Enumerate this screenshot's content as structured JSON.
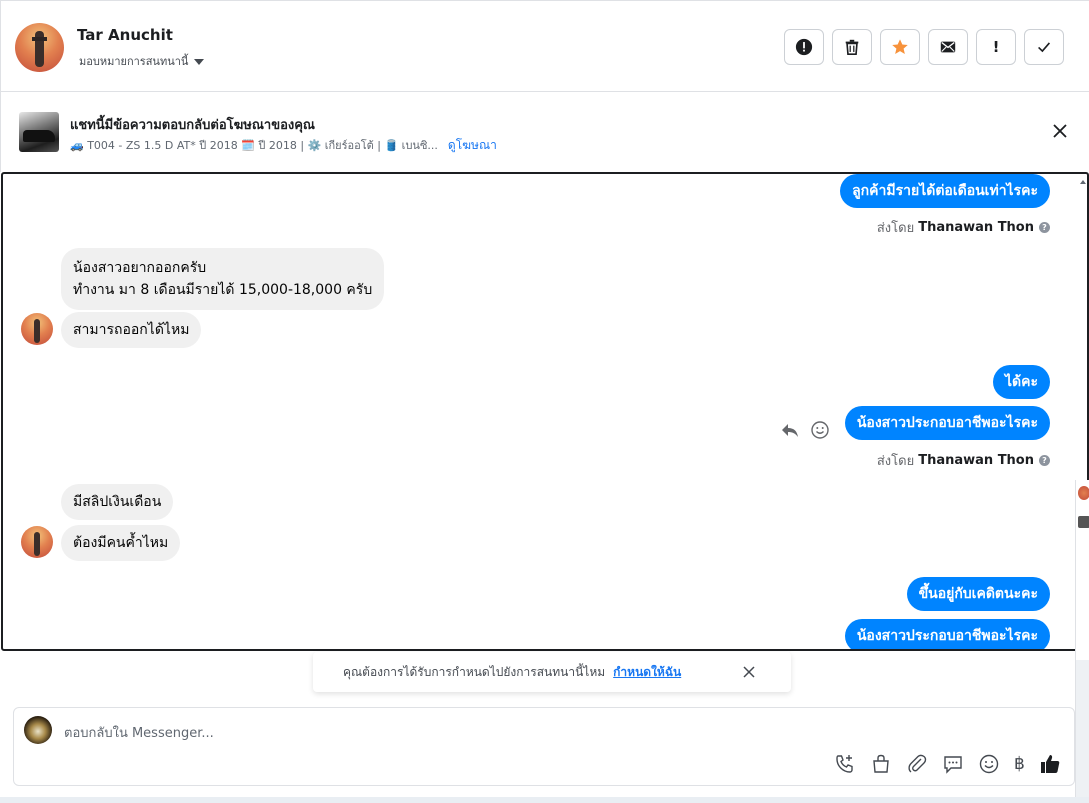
{
  "header": {
    "contact_name": "Tar Anuchit",
    "assign_label": "มอบหมายการสนทนานี้",
    "toolbar": [
      {
        "name": "spam-button",
        "icon": "alert-circle-icon"
      },
      {
        "name": "delete-button",
        "icon": "trash-icon"
      },
      {
        "name": "star-button",
        "icon": "star-icon"
      },
      {
        "name": "mark-unread-button",
        "icon": "envelope-icon"
      },
      {
        "name": "follow-up-button",
        "icon": "exclamation-icon",
        "glyph": "!"
      },
      {
        "name": "mark-done-button",
        "icon": "check-icon"
      }
    ],
    "star_color": "#f7923b"
  },
  "ad": {
    "title": "แชทนี้มีข้อความตอบกลับต่อโฆษณาของคุณ",
    "meta": "🚙 T004 - ZS 1.5 D AT* ปี 2018 🗓️ ปี 2018 | ⚙️ เกียร์ออโต้ | 🛢️ เบนซิ...",
    "link": "ดูโฆษณา"
  },
  "messages": {
    "out_1": "ลูกค้ามีรายได้ต่อเดือนเท่าไรคะ",
    "sent_by_1_prefix": "ส่งโดย",
    "sent_by_1_name": "Thanawan Thon",
    "in_1_line1": "น้องสาวอยากออกครับ",
    "in_1_line2": "ทำงาน มา 8 เดือนมีรายได้ 15,000-18,000 ครับ",
    "in_2": "สามารถออกได้ไหม",
    "out_2": "ได้คะ",
    "out_3": "น้องสาวประกอบอาชีพอะไรคะ",
    "sent_by_2_prefix": "ส่งโดย",
    "sent_by_2_name": "Thanawan Thon",
    "in_3": "มีสลิปเงินเดือน",
    "in_4": "ต้องมีคนค้ำไหม",
    "out_4": "ขึ้นอยู่กับเคดิตนะคะ",
    "out_5": "น้องสาวประกอบอาชีพอะไรคะ",
    "bubble_color": "#0084ff"
  },
  "reminder": {
    "text": "คุณต้องการได้รับการกำหนดไปยังการสนทนานี้ไหม",
    "action": "กำหนดให้ฉัน"
  },
  "composer": {
    "placeholder": "ตอบกลับใน Messenger...",
    "icons": [
      "call-add-icon",
      "shopping-bag-icon",
      "attachment-icon",
      "saved-reply-icon",
      "emoji-icon",
      "baht-icon",
      "like-icon"
    ],
    "baht_glyph": "฿"
  }
}
